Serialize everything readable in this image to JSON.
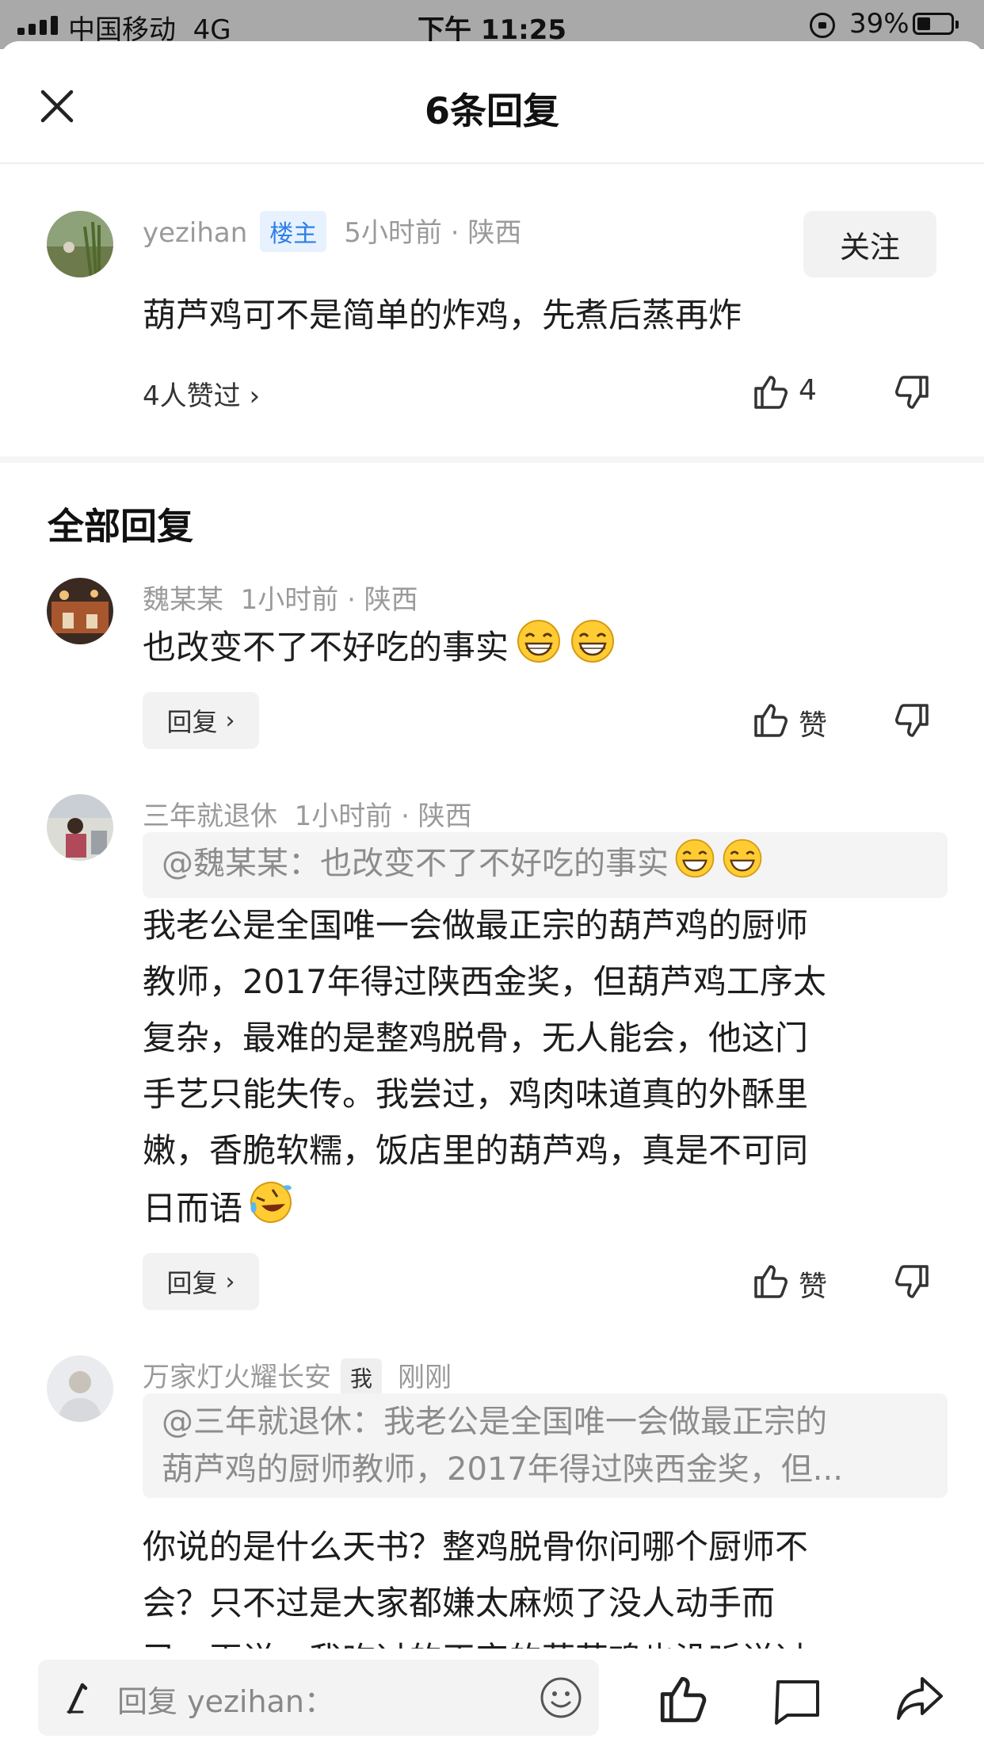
{
  "status_bar": {
    "carrier": "中国移动",
    "network": "4G",
    "time": "下午 11:25",
    "battery_percent": "39%",
    "battery_level": 0.39
  },
  "header": {
    "title": "6条回复"
  },
  "main_comment": {
    "username": "yezihan",
    "badge": "楼主",
    "meta": "5小时前 · 陕西",
    "follow_label": "关注",
    "text": "葫芦鸡可不是简单的炸鸡，先煮后蒸再炸",
    "liked_by": "4人赞过",
    "like_count": "4"
  },
  "replies_section": {
    "title": "全部回复"
  },
  "replies": [
    {
      "username": "魏某某",
      "meta": "1小时前 · 陕西",
      "text": "也改变不了不好吃的事实",
      "reply_label": "回复",
      "like_label": "赞"
    },
    {
      "username": "三年就退休",
      "meta": "1小时前 · 陕西",
      "quote": "@魏某某：也改变不了不好吃的事实",
      "text_lines": [
        "我老公是全国唯一会做最正宗的葫芦鸡的厨师",
        "教师，2017年得过陕西金奖，但葫芦鸡工序太",
        "复杂，最难的是整鸡脱骨，无人能会，他这门",
        "手艺只能失传。我尝过，鸡肉味道真的外酥里",
        "嫩，香脆软糯，饭店里的葫芦鸡，真是不可同",
        "日而语"
      ],
      "reply_label": "回复",
      "like_label": "赞"
    },
    {
      "username": "万家灯火耀长安",
      "badge": "我",
      "meta": "刚刚",
      "quote_lines": [
        "@三年就退休：我老公是全国唯一会做最正宗的",
        "葫芦鸡的厨师教师，2017年得过陕西金奖，但..."
      ],
      "text_lines": [
        "你说的是什么天书？整鸡脱骨你问哪个厨师不",
        "会？只不过是大家都嫌太麻烦了没人动手而",
        "已。再说，我吃过的正宗的葫芦鸡也没听说过"
      ]
    }
  ],
  "bottom_bar": {
    "placeholder": "回复 yezihan："
  }
}
